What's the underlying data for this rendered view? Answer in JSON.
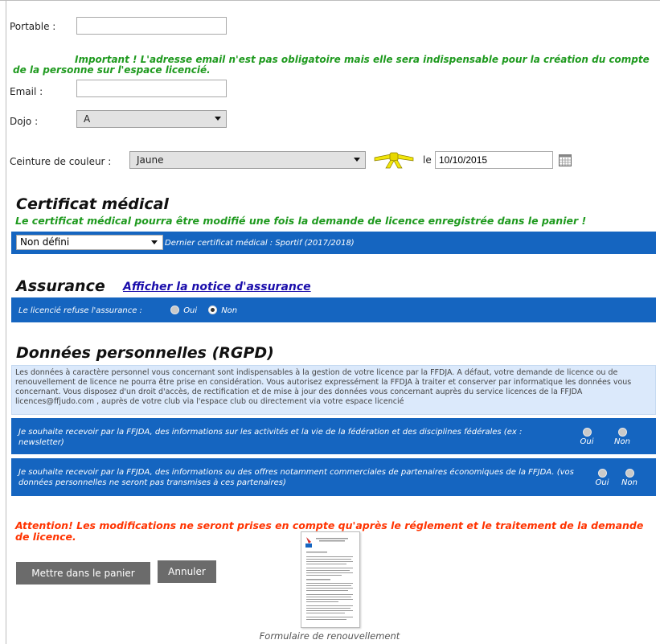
{
  "form": {
    "portable_label": "Portable :",
    "portable_value": "",
    "email_notice": "Important ! L'adresse email n'est pas obligatoire mais elle sera indispensable pour la création du compte de la personne sur l'espace licencié.",
    "email_label": "Email :",
    "email_value": "",
    "dojo_label": "Dojo :",
    "dojo_value": "A",
    "belt_label": "Ceinture de couleur :",
    "belt_value": "Jaune",
    "belt_color": "#f2e60a",
    "date_prefix": "le",
    "date_value": "10/10/2015"
  },
  "certificate": {
    "title": "Certificat médical",
    "notice": "Le certificat médical pourra être modifié une fois la demande de licence enregistrée dans le panier !",
    "select_value": "Non défini",
    "last_certificate": "Dernier certificat médical : Sportif (2017/2018)"
  },
  "insurance": {
    "title": "Assurance",
    "notice_link": "Afficher la notice d'assurance",
    "refuse_label": "Le licencié refuse l'assurance :",
    "option_yes": "Oui",
    "option_no": "Non",
    "selected": "Non"
  },
  "gdpr": {
    "title": "Données personnelles (RGPD)",
    "info_text": "Les données à caractère personnel vous concernant sont indispensables à la gestion de votre licence par la FFDJA. A défaut, votre demande de licence ou de renouvellement de licence ne pourra être prise en considération. Vous autorisez expressément la FFDJA à traiter et conserver par informatique les données vous concernant. Vous disposez d'un droit d'accès, de rectification et de mise à jour des données vous concernant auprès du service licences de la FFJDA licences@ffjudo.com , auprès de votre club via l'espace club ou directement via votre espace licencié",
    "consent1": "Je souhaite recevoir par la FFJDA, des informations sur les activités et la vie de la fédération et des disciplines fédérales (ex : newsletter)",
    "consent2": "Je souhaite recevoir par la FFJDA, des informations ou des offres notamment commerciales de partenaires économiques de la FFJDA. (vos données personnelles ne seront pas transmises à ces partenaires)",
    "option_yes": "Oui",
    "option_no": "Non"
  },
  "footer": {
    "warning": "Attention! Les modifications ne seront prises en compte qu'après le réglement et le traitement de la demande de licence.",
    "add_to_cart": "Mettre dans le panier",
    "cancel": "Annuler",
    "document_caption": "Formulaire de renouvellement"
  },
  "colors": {
    "accent_blue": "#1565c0",
    "notice_green": "#1f9a1f",
    "warning_red": "#ff3300",
    "link_blue": "#1a0dab"
  },
  "icons": {
    "calendar": "calendar-icon",
    "belt": "belt-icon",
    "document": "document-thumbnail"
  }
}
